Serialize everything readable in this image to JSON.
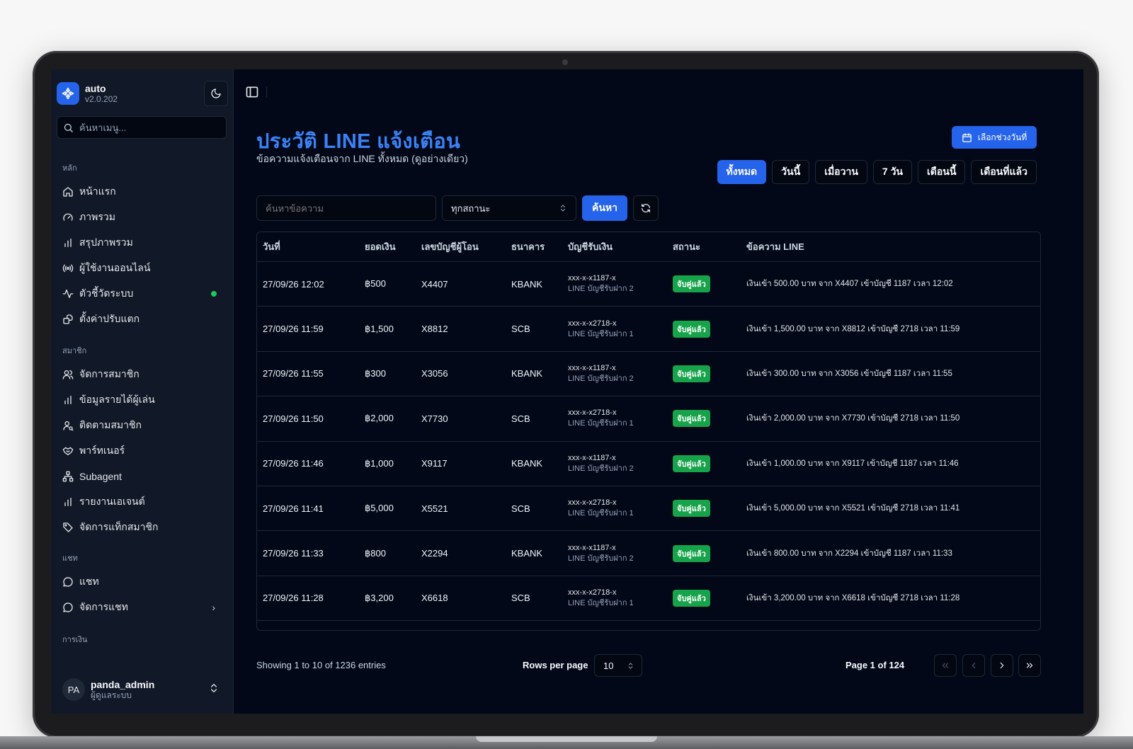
{
  "app": {
    "name": "auto",
    "version": "v2.0.202"
  },
  "sidebar": {
    "search_placeholder": "ค้นหาเมนู...",
    "sections": {
      "main": "หลัก",
      "members": "สมาชิก",
      "chat": "แชท",
      "finance": "การเงิน"
    },
    "items": [
      {
        "label": "หน้าแรก",
        "icon": "home-icon"
      },
      {
        "label": "ภาพรวม",
        "icon": "gauge-icon"
      },
      {
        "label": "สรุปภาพรวม",
        "icon": "bar-chart-icon"
      },
      {
        "label": "ผู้ใช้งานออนไลน์",
        "icon": "radio-icon"
      },
      {
        "label": "ตัวชี้วัดระบบ",
        "icon": "activity-icon"
      },
      {
        "label": "ตั้งค่าปรับแตก",
        "icon": "settings-share-icon"
      },
      {
        "label": "จัดการสมาชิก",
        "icon": "users-icon"
      },
      {
        "label": "ข้อมูลรายได้ผู้เล่น",
        "icon": "bar-chart-icon"
      },
      {
        "label": "ติดตามสมาชิก",
        "icon": "user-search-icon"
      },
      {
        "label": "พาร์ทเนอร์",
        "icon": "handshake-icon"
      },
      {
        "label": "Subagent",
        "icon": "network-icon"
      },
      {
        "label": "รายงานเอเจนต์",
        "icon": "bar-chart-icon"
      },
      {
        "label": "จัดการแท็กสมาชิก",
        "icon": "tag-icon"
      },
      {
        "label": "แชท",
        "icon": "message-circle-icon"
      },
      {
        "label": "จัดการแชท",
        "icon": "message-circle-icon"
      }
    ],
    "status_color": "#22c55e"
  },
  "user": {
    "initials": "PA",
    "name": "panda_admin",
    "role": "ผู้ดูแลระบบ"
  },
  "page": {
    "title": "ประวัติ LINE แจ้งเตือน",
    "subtitle": "ข้อความแจ้งเตือนจาก LINE ทั้งหมด (ดูอย่างเดียว)",
    "date_range_button": "เลือกช่วงวันที่",
    "filters": [
      "ทั้งหมด",
      "วันนี้",
      "เมื่อวาน",
      "7 วัน",
      "เดือนนี้",
      "เดือนที่แล้ว"
    ],
    "active_filter": "ทั้งหมด",
    "search_placeholder": "ค้นหาข้อความ",
    "status_select": "ทุกสถานะ",
    "search_button": "ค้นหา"
  },
  "table": {
    "headers": [
      "วันที่",
      "ยอดเงิน",
      "เลขบัญชีผู้โอน",
      "ธนาคาร",
      "บัญชีรับเงิน",
      "สถานะ",
      "ข้อความ LINE"
    ],
    "rows": [
      {
        "date": "27/09/26 12:02",
        "amount": "฿500",
        "sender": "X4407",
        "bank": "KBANK",
        "acct": "xxx-x-x1187-x",
        "acct_sub": "LINE บัญชีรับฝาก 2",
        "status": "จับคู่แล้ว",
        "message": "เงินเข้า 500.00 บาท จาก X4407 เข้าบัญชี 1187 เวลา 12:02"
      },
      {
        "date": "27/09/26 11:59",
        "amount": "฿1,500",
        "sender": "X8812",
        "bank": "SCB",
        "acct": "xxx-x-x2718-x",
        "acct_sub": "LINE บัญชีรับฝาก 1",
        "status": "จับคู่แล้ว",
        "message": "เงินเข้า 1,500.00 บาท จาก X8812 เข้าบัญชี 2718 เวลา 11:59"
      },
      {
        "date": "27/09/26 11:55",
        "amount": "฿300",
        "sender": "X3056",
        "bank": "KBANK",
        "acct": "xxx-x-x1187-x",
        "acct_sub": "LINE บัญชีรับฝาก 2",
        "status": "จับคู่แล้ว",
        "message": "เงินเข้า 300.00 บาท จาก X3056 เข้าบัญชี 1187 เวลา 11:55"
      },
      {
        "date": "27/09/26 11:50",
        "amount": "฿2,000",
        "sender": "X7730",
        "bank": "SCB",
        "acct": "xxx-x-x2718-x",
        "acct_sub": "LINE บัญชีรับฝาก 1",
        "status": "จับคู่แล้ว",
        "message": "เงินเข้า 2,000.00 บาท จาก X7730 เข้าบัญชี 2718 เวลา 11:50"
      },
      {
        "date": "27/09/26 11:46",
        "amount": "฿1,000",
        "sender": "X9117",
        "bank": "KBANK",
        "acct": "xxx-x-x1187-x",
        "acct_sub": "LINE บัญชีรับฝาก 2",
        "status": "จับคู่แล้ว",
        "message": "เงินเข้า 1,000.00 บาท จาก X9117 เข้าบัญชี 1187 เวลา 11:46"
      },
      {
        "date": "27/09/26 11:41",
        "amount": "฿5,000",
        "sender": "X5521",
        "bank": "SCB",
        "acct": "xxx-x-x2718-x",
        "acct_sub": "LINE บัญชีรับฝาก 1",
        "status": "จับคู่แล้ว",
        "message": "เงินเข้า 5,000.00 บาท จาก X5521 เข้าบัญชี 2718 เวลา 11:41"
      },
      {
        "date": "27/09/26 11:33",
        "amount": "฿800",
        "sender": "X2294",
        "bank": "KBANK",
        "acct": "xxx-x-x1187-x",
        "acct_sub": "LINE บัญชีรับฝาก 2",
        "status": "จับคู่แล้ว",
        "message": "เงินเข้า 800.00 บาท จาก X2294 เข้าบัญชี 1187 เวลา 11:33"
      },
      {
        "date": "27/09/26 11:28",
        "amount": "฿3,200",
        "sender": "X6618",
        "bank": "SCB",
        "acct": "xxx-x-x2718-x",
        "acct_sub": "LINE บัญชีรับฝาก 1",
        "status": "จับคู่แล้ว",
        "message": "เงินเข้า 3,200.00 บาท จาก X6618 เข้าบัญชี 2718 เวลา 11:28"
      }
    ]
  },
  "pagination": {
    "showing": "Showing 1 to 10 of 1236 entries",
    "rows_per_page_label": "Rows per page",
    "rows_per_page": "10",
    "page_info": "Page 1 of 124"
  },
  "colors": {
    "accent": "#2563eb",
    "title": "#3b82f6",
    "badge": "#16a34a",
    "background": "#020817"
  }
}
